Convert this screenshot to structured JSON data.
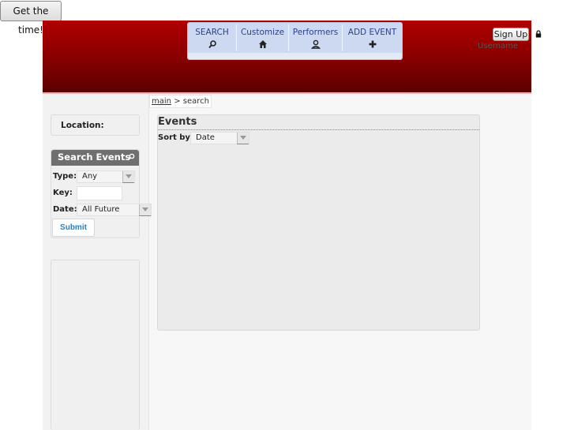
{
  "top_button": {
    "label": "Get the time!"
  },
  "nav": {
    "items": [
      {
        "label": "SEARCH",
        "icon": "search-icon"
      },
      {
        "label": "Customize",
        "icon": "home-icon"
      },
      {
        "label": "Performers",
        "icon": "person-icon"
      },
      {
        "label": "ADD EVENT",
        "icon": "plus-icon"
      }
    ]
  },
  "account": {
    "signup_label": "Sign Up",
    "username_label": "Username"
  },
  "breadcrumb": {
    "root": "main",
    "separator": ">",
    "current": "search"
  },
  "sidebar": {
    "location_label": "Location:",
    "search_title": "Search Events",
    "type_label": "Type:",
    "type_value": "Any",
    "key_label": "Key:",
    "key_value": "",
    "date_label": "Date:",
    "date_value": "All Future",
    "submit_label": "Submit"
  },
  "events": {
    "title": "Events",
    "sort_label": "Sort by:",
    "sort_value": "Date"
  },
  "colors": {
    "header_red": "#8e0000",
    "nav_bg": "#cdd9f1",
    "nav_text": "#2b3f8e",
    "submit_text": "#2b7fbf"
  }
}
